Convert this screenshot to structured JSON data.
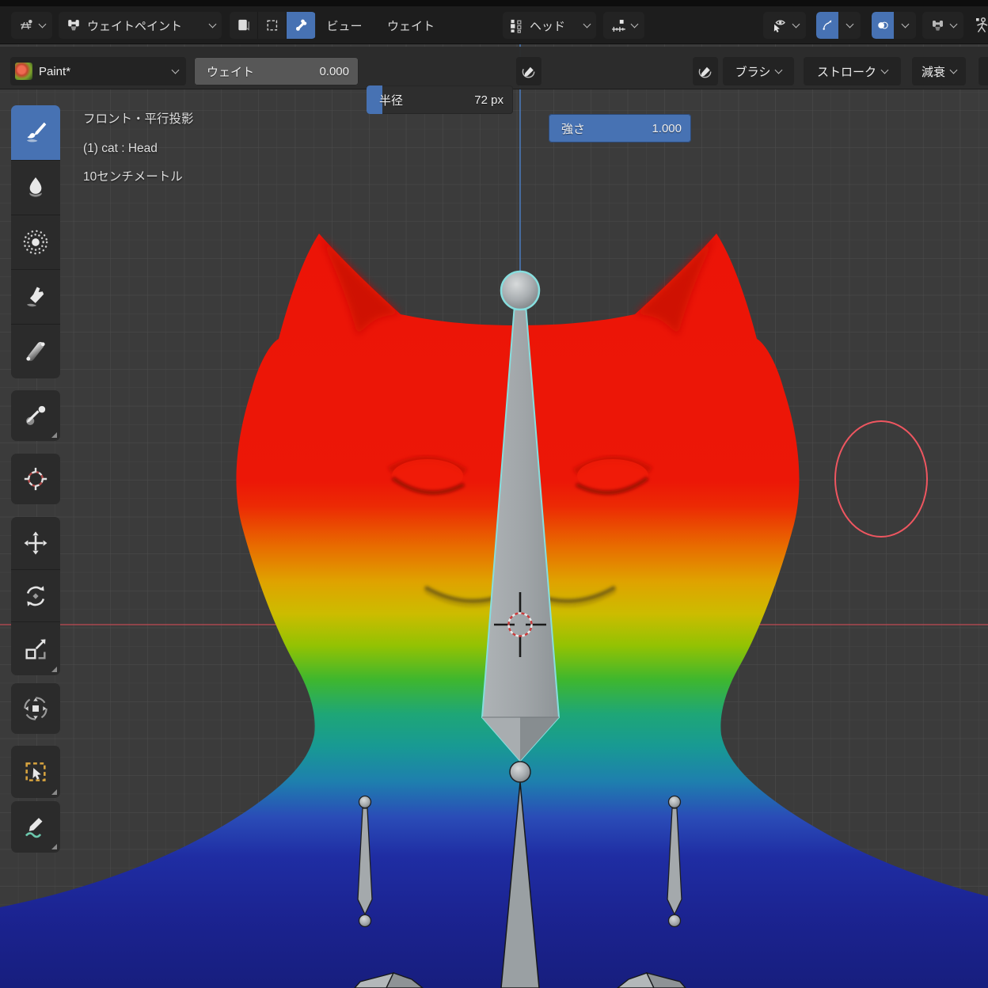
{
  "header": {
    "editor_selector": {
      "icon": "editor-3d-viewport-icon"
    },
    "mode_dropdown": {
      "label": "ウェイトペイント",
      "icon": "weight-paint-mode-icon"
    },
    "mask_toggles": [
      {
        "icon": "face-select-mask-icon",
        "active": false
      },
      {
        "icon": "vertex-select-mask-icon",
        "active": false
      },
      {
        "icon": "bone-select-icon",
        "active": true
      }
    ],
    "menus": [
      {
        "label": "ビュー"
      },
      {
        "label": "ウェイト"
      }
    ],
    "bone_dropdown": {
      "label": "ヘッド",
      "icon": "bone-collections-icon"
    },
    "snap_dropdown": {
      "icon": "snap-increment-icon"
    },
    "right_controls": [
      {
        "icon": "visibility-eye-pointer-icon",
        "active": false
      },
      {
        "icon": "gizmo-icon",
        "active": true
      },
      {
        "icon": "overlays-icon",
        "active": true
      },
      {
        "icon": "weight-paint-shading-icon",
        "active": false
      },
      {
        "icon": "armature-pose-icon",
        "active": false
      }
    ]
  },
  "tool_settings": {
    "brush_selector": {
      "label": "Paint*",
      "icon": "brush-thumbnail"
    },
    "weight_slider": {
      "label": "ウェイト",
      "value": "0.000"
    },
    "radius_slider": {
      "label": "半径",
      "value": "72 px",
      "fill_percent": 10
    },
    "strength_slider": {
      "label": "強さ",
      "value": "1.000",
      "fill_percent": 100
    },
    "pressure_toggle_icon": "stylus-pressure-icon",
    "popovers": [
      {
        "label": "ブラシ"
      },
      {
        "label": "ストローク"
      },
      {
        "label": "減衰"
      }
    ]
  },
  "toolbar": {
    "tools": [
      {
        "name": "draw-brush",
        "icon": "brush-icon",
        "active": true
      },
      {
        "name": "blur",
        "icon": "blur-droplet-icon",
        "active": false
      },
      {
        "name": "average",
        "icon": "average-dots-icon",
        "active": false
      },
      {
        "name": "smear",
        "icon": "smear-icon",
        "active": false
      },
      {
        "name": "gradient",
        "icon": "gradient-icon",
        "active": false
      },
      {
        "name": "sample-weight",
        "icon": "eyedropper-icon",
        "active": false
      },
      {
        "name": "cursor",
        "icon": "cursor-3d-icon",
        "active": false
      },
      {
        "name": "move",
        "icon": "move-icon",
        "active": false
      },
      {
        "name": "rotate",
        "icon": "rotate-icon",
        "active": false
      },
      {
        "name": "scale",
        "icon": "scale-icon",
        "active": false
      },
      {
        "name": "transform",
        "icon": "transform-icon",
        "active": false
      },
      {
        "name": "select-box",
        "icon": "select-box-icon",
        "active": false
      },
      {
        "name": "annotate",
        "icon": "annotate-icon",
        "active": false
      }
    ]
  },
  "viewport": {
    "overlay_lines": [
      "フロント・平行投影",
      "(1) cat : Head",
      "10センチメートル"
    ],
    "brush_cursor_radius_px": 72,
    "colors": {
      "accent_blue": "#4772b3",
      "viewport_bg": "#3b3b3b",
      "grid_line": "#454545",
      "axis_x_red": "#aa4850",
      "axis_z_blue": "#4a78b8",
      "bone_selected_outline": "#87dede",
      "brush_cursor_red": "#ef5660",
      "weight_max_red": "#ec1407",
      "weight_min_blue": "#1b2390"
    }
  }
}
